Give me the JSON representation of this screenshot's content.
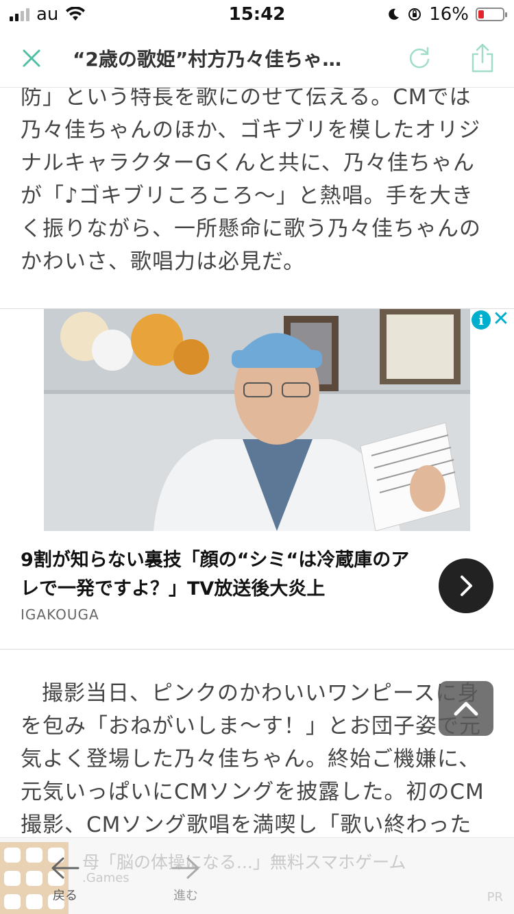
{
  "status_bar": {
    "carrier": "au",
    "time": "15:42",
    "battery": "16%",
    "battery_level": 0.16
  },
  "nav": {
    "title": "“2歳の歌姫”村方乃々佳ちゃ…",
    "close_icon": "close-icon",
    "reload_icon": "reload-icon",
    "share_icon": "share-icon",
    "accent": "#4fbfa3"
  },
  "article": {
    "para_top": "防」という特長を歌にのせて伝える。CMでは乃々佳ちゃんのほか、ゴキブリを模したオリジナルキャラクターGくんと共に、乃々佳ちゃんが「♪ゴキブリころころ～」と熱唱。手を大きく振りながら、一所懸命に歌う乃々佳ちゃんのかわいさ、歌唱力は必見だ。",
    "para_bottom": "撮影当日、ピンクのかわいいワンピースに身を包み「おねがいしま～す！」とお団子姿で元気よく登場した乃々佳ちゃん。終始ご機嫌に、元気いっぱいにCMソングを披露した。初のCM撮影、CMソング歌唱を満喫し「歌い終わった"
  },
  "ad": {
    "headline": "9割が知らない裏技「顔の“シミ“は冷蔵庫のアレで一発ですよ？」TV放送後大炎上",
    "source": "IGAKOUGA",
    "info_glyph": "i",
    "close_glyph": "✕",
    "accent": "#00aecd"
  },
  "bottom": {
    "ad_title": "母「脳の体操になる...」無料スマホゲーム",
    "ad_source": ".Games",
    "back_label": "戻る",
    "forward_label": "進む",
    "pr_label": "PR"
  }
}
